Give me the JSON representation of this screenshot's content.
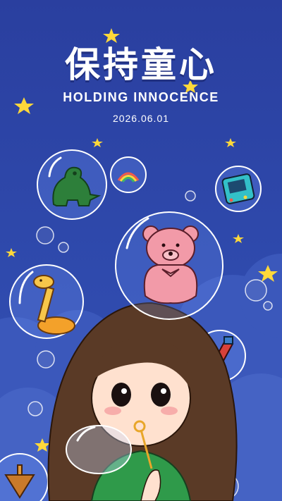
{
  "poster": {
    "title": "保持童心",
    "subtitle": "HOLDING INNOCENCE",
    "date": "2026.06.01"
  },
  "colors": {
    "background": "#2c45a8",
    "star": "#ffd83a",
    "bubble_rim": "#ffffff",
    "hair": "#5a3a26",
    "shirt": "#2f9a4a",
    "bear": "#f29aa8",
    "dinosaur": "#2d7f3a"
  },
  "icons": [
    "star-icon",
    "bubble-icon",
    "dinosaur-icon",
    "rainbow-icon",
    "game-console-icon",
    "teddy-bear-icon",
    "giraffe-toy-icon",
    "guitar-icon",
    "spinning-top-icon"
  ]
}
